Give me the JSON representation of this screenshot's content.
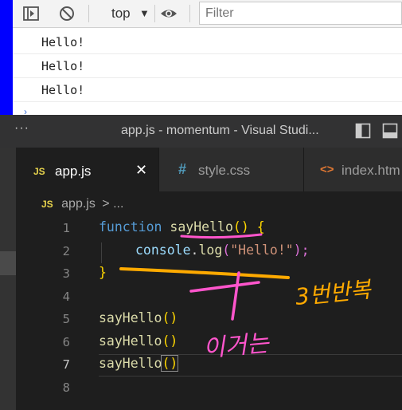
{
  "devtools": {
    "toolbar": {
      "sidebar_icon": "sidebar-toggle-icon",
      "clear_icon": "clear-console-icon",
      "context": "top",
      "eye_icon": "live-expression-eye-icon",
      "filter_placeholder": "Filter"
    },
    "logs": [
      "Hello!",
      "Hello!",
      "Hello!"
    ]
  },
  "vscode": {
    "more_label": "···",
    "window_title": "app.js - momentum - Visual Studi...",
    "tabs": [
      {
        "icon_text": "JS",
        "label": "app.js",
        "active": true,
        "close": "✕"
      },
      {
        "icon_text": "#",
        "label": "style.css",
        "active": false
      },
      {
        "icon_text": "<>",
        "label": "index.htm",
        "active": false
      }
    ],
    "breadcrumb": {
      "icon_text": "JS",
      "file": "app.js",
      "sep": "> ..."
    },
    "line_numbers": [
      "1",
      "2",
      "3",
      "4",
      "5",
      "6",
      "7",
      "8"
    ],
    "code": {
      "l1_kw": "function",
      "l1_name": "sayHello",
      "l1_parens": "()",
      "l1_brace": "{",
      "l2_obj": "console",
      "l2_dot": ".",
      "l2_method": "log",
      "l2_open": "(",
      "l2_str": "\"Hello!\"",
      "l2_close": ");",
      "l3_brace": "}",
      "call_name": "sayHello",
      "call_parens": "()"
    },
    "colors": {
      "keyword": "#569cd6",
      "function": "#dcdcaa",
      "string": "#ce9178",
      "variable": "#9cdcfe"
    }
  },
  "annotations": {
    "note_right": "3번반복",
    "note_bottom": "이거는",
    "ink_pink": "#ff66cc",
    "ink_orange": "#ffaa00"
  }
}
